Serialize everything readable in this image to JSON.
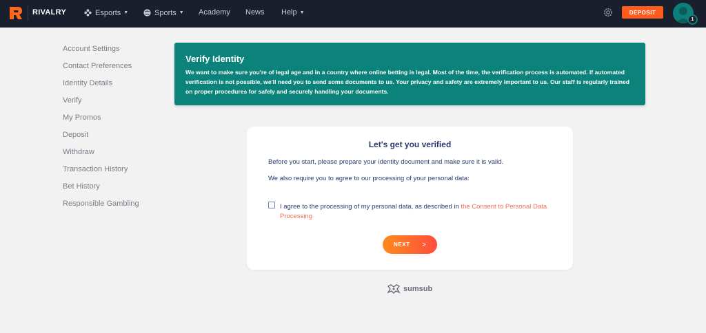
{
  "nav": {
    "brand": "RIVALRY",
    "items": [
      {
        "label": "Esports",
        "has_caret": true,
        "icon": "gamepad-icon"
      },
      {
        "label": "Sports",
        "has_caret": true,
        "icon": "globe-icon"
      },
      {
        "label": "Academy",
        "has_caret": false
      },
      {
        "label": "News",
        "has_caret": false
      },
      {
        "label": "Help",
        "has_caret": true
      }
    ],
    "deposit_label": "DEPOSIT",
    "avatar_badge": "1"
  },
  "sidebar": {
    "items": [
      {
        "label": "Account Settings"
      },
      {
        "label": "Contact Preferences"
      },
      {
        "label": "Identity Details"
      },
      {
        "label": "Verify"
      },
      {
        "label": "My Promos"
      },
      {
        "label": "Deposit"
      },
      {
        "label": "Withdraw"
      },
      {
        "label": "Transaction History"
      },
      {
        "label": "Bet History"
      },
      {
        "label": "Responsible Gambling"
      }
    ]
  },
  "banner": {
    "title": "Verify Identity",
    "text": "We want to make sure you're of legal age and in a country where online betting is legal. Most of the time, the verification process is automated. If automated verification is not possible, we'll need you to send some documents to us. Your privacy and safety are extremely important to us. Our staff is regularly trained on proper procedures for safely and securely handling your documents."
  },
  "card": {
    "title": "Let's get you verified",
    "line1": "Before you start, please prepare your identity document and make sure it is valid.",
    "line2": "We also require you to agree to our processing of your personal data:",
    "consent_text": "I agree to the processing of my personal data, as described in ",
    "consent_link": "the Consent to Personal Data Processing",
    "next_label": "NEXT",
    "next_arrow": ">"
  },
  "footer": {
    "provider": "sumsub"
  },
  "colors": {
    "nav_bg": "#1a1f2e",
    "accent": "#ff5b1f",
    "banner": "#0b827a",
    "card_text": "#2b3a6e",
    "link": "#f26c4f"
  }
}
